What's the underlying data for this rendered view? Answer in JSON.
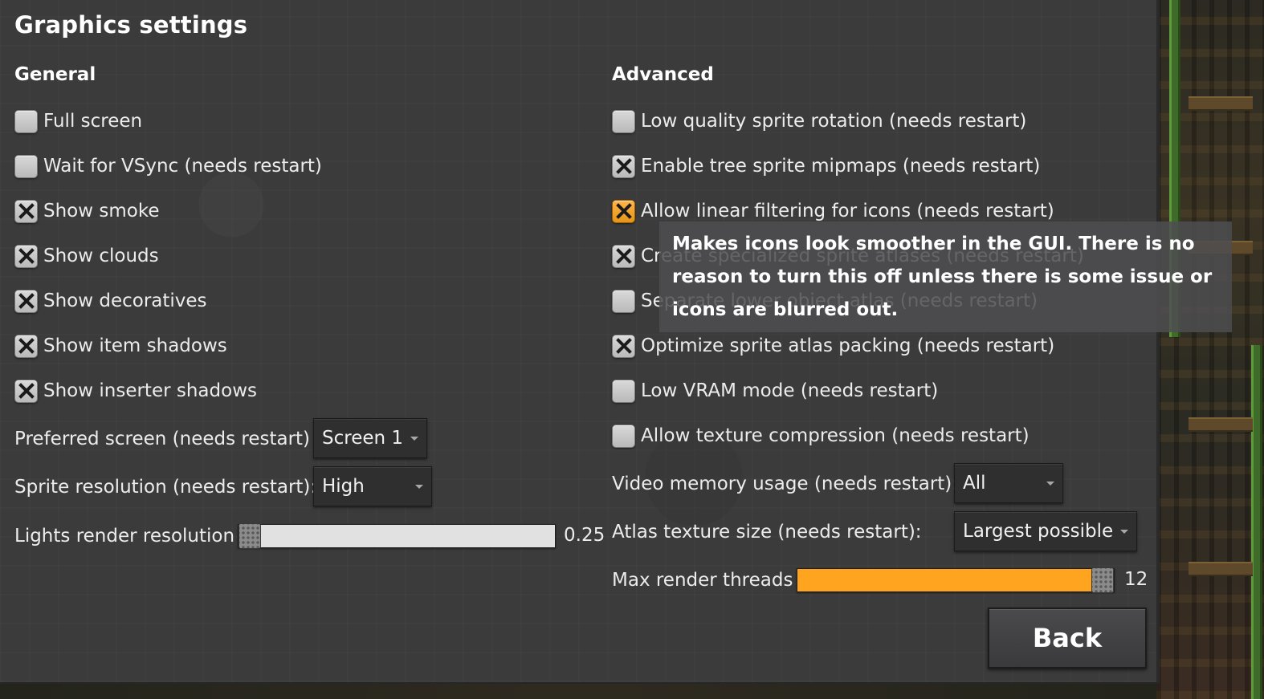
{
  "title": "Graphics settings",
  "general": {
    "heading": "General",
    "checkboxes": [
      {
        "label": "Full screen",
        "checked": false
      },
      {
        "label": "Wait for VSync (needs restart)",
        "checked": false
      },
      {
        "label": "Show smoke",
        "checked": true
      },
      {
        "label": "Show clouds",
        "checked": true
      },
      {
        "label": "Show decoratives",
        "checked": true
      },
      {
        "label": "Show item shadows",
        "checked": true
      },
      {
        "label": "Show inserter shadows",
        "checked": true
      }
    ],
    "preferred_screen": {
      "label": "Preferred screen (needs restart)",
      "value": "Screen 1"
    },
    "sprite_resolution": {
      "label": "Sprite resolution (needs restart):",
      "value": "High"
    },
    "lights_render": {
      "label": "Lights render resolution",
      "value_text": "0.25",
      "fraction": 0.0
    }
  },
  "advanced": {
    "heading": "Advanced",
    "checkboxes": [
      {
        "label": "Low quality sprite rotation (needs restart)",
        "checked": false
      },
      {
        "label": "Enable tree sprite mipmaps (needs restart)",
        "checked": true
      },
      {
        "label": "Allow linear filtering for icons (needs restart)",
        "checked": true,
        "hovered": true
      },
      {
        "label": "Create specialized sprite atlases (needs restart)",
        "checked": true
      },
      {
        "label": "Separate lower object atlas (needs restart)",
        "checked": false
      },
      {
        "label": "Optimize sprite atlas packing (needs restart)",
        "checked": true
      },
      {
        "label": "Low VRAM mode (needs restart)",
        "checked": false
      },
      {
        "label": "Allow texture compression (needs restart)",
        "checked": false
      }
    ],
    "video_memory": {
      "label": "Video memory usage (needs restart):",
      "value": "All"
    },
    "atlas_size": {
      "label": "Atlas texture size (needs restart):",
      "value": "Largest possible"
    },
    "max_threads": {
      "label": "Max render threads",
      "value_text": "12",
      "fraction": 1.0
    }
  },
  "tooltip": {
    "text": "Makes icons look smoother in the GUI. There is no reason to turn this off unless there is some issue or icons are blurred out."
  },
  "back_label": "Back",
  "colors": {
    "accent": "#ffa41e",
    "panel": "#3b3b3c",
    "checkbox": "#c8c8c8"
  }
}
